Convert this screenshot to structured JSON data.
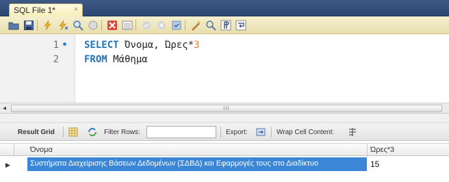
{
  "tab": {
    "title": "SQL File 1*",
    "close": "×"
  },
  "toolbar": {
    "icons": [
      "open-folder-icon",
      "save-icon",
      "execute-icon",
      "execute-current-icon",
      "explain-icon",
      "stop-icon",
      "toggle-error-icon",
      "toggle-output-icon",
      "commit-icon",
      "rollback-icon",
      "autocommit-icon",
      "beautify-icon",
      "find-icon",
      "invisible-chars-icon",
      "wrap-icon"
    ],
    "colors": {
      "bg": "#f0e8c0",
      "tab_strip": "#2f4a75"
    }
  },
  "editor": {
    "lines": [
      {
        "number": "1",
        "keyword": "SELECT",
        "text": " Όνομα, Ώρες*",
        "number_literal": "3",
        "marker": true
      },
      {
        "number": "2",
        "keyword": "FROM",
        "text": " Μάθημα",
        "number_literal": "",
        "marker": false
      }
    ],
    "colors": {
      "keyword": "#1f73b8",
      "number": "#e37c21"
    }
  },
  "scrollbar": {
    "left_arrow": "◂",
    "thumb_grip": "III"
  },
  "result_toolbar": {
    "result_grid": "Result Grid",
    "filter_rows": "Filter Rows:",
    "filter_value": "",
    "export": "Export:",
    "wrap": "Wrap Cell Content:"
  },
  "grid": {
    "columns": [
      "Όνομα",
      "Ώρες*3"
    ],
    "row_indicator": "▶",
    "rows": [
      {
        "name": "Συστήματα Διαχείρισης Βάσεων Δεδομένων (ΣΔΒΔ) και Εφαρμογές τους στο Διαδίκτυο",
        "value": "15"
      }
    ],
    "selection_color": "#3b86d6"
  }
}
